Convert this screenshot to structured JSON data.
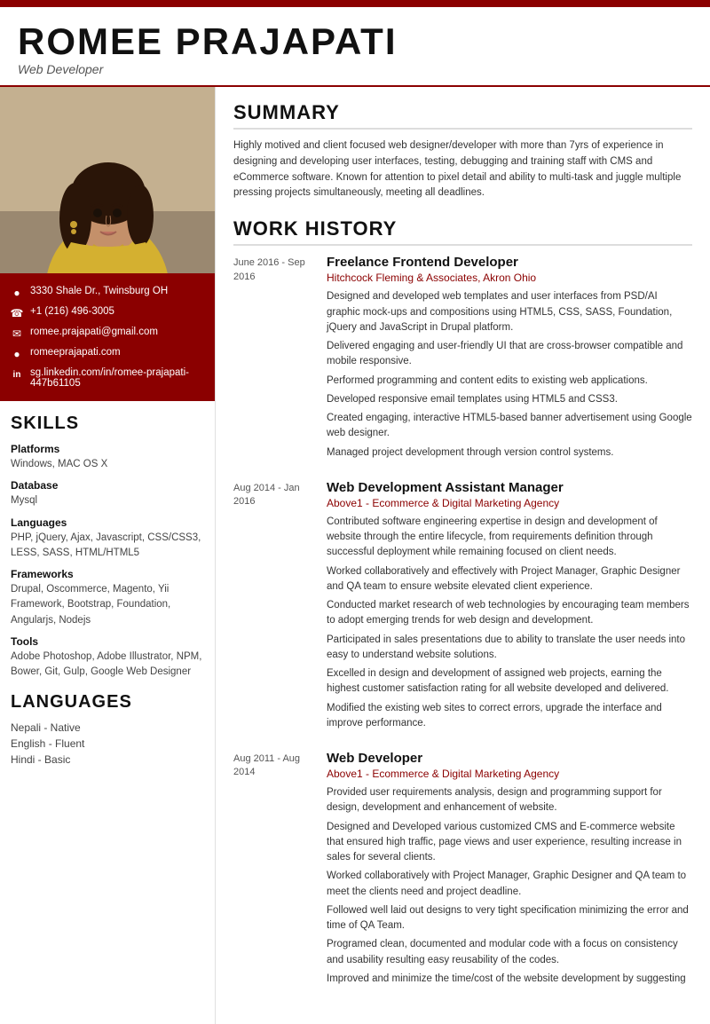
{
  "topbar": {},
  "header": {
    "name": "ROMEE PRAJAPATI",
    "title": "Web Developer"
  },
  "contact": {
    "address": "3330 Shale Dr., Twinsburg OH",
    "phone": "+1 (216) 496-3005",
    "email": "romee.prajapati@gmail.com",
    "website": "romeeprajapati.com",
    "linkedin": "sg.linkedin.com/in/romee-prajapati-447b61105"
  },
  "skills": {
    "section_title": "SKILLS",
    "categories": [
      {
        "name": "Platforms",
        "values": "Windows, MAC OS X"
      },
      {
        "name": "Database",
        "values": "Mysql"
      },
      {
        "name": "Languages",
        "values": "PHP, jQuery, Ajax, Javascript, CSS/CSS3, LESS, SASS, HTML/HTML5"
      },
      {
        "name": "Frameworks",
        "values": "Drupal, Oscommerce, Magento, Yii Framework, Bootstrap, Foundation, Angularjs, Nodejs"
      },
      {
        "name": "Tools",
        "values": "Adobe Photoshop, Adobe Illustrator, NPM, Bower, Git, Gulp, Google Web Designer"
      }
    ]
  },
  "languages": {
    "section_title": "LANGUAGES",
    "items": [
      "Nepali - Native",
      "English - Fluent",
      "Hindi - Basic"
    ]
  },
  "summary": {
    "section_title": "SUMMARY",
    "text": "Highly motived and client focused web designer/developer with more than 7yrs of experience in designing and developing user interfaces, testing, debugging and training staff with CMS and eCommerce software. Known for attention to pixel detail and ability to multi-task and juggle multiple pressing projects simultaneously, meeting all deadlines."
  },
  "work_history": {
    "section_title": "WORK HISTORY",
    "entries": [
      {
        "date": "June 2016 - Sep 2016",
        "title": "Freelance Frontend Developer",
        "company": "Hitchcock Fleming & Associates, Akron Ohio",
        "bullets": [
          "Designed and developed web templates and user interfaces from PSD/AI graphic mock-ups and compositions using HTML5, CSS, SASS, Foundation, jQuery and JavaScript in Drupal platform.",
          "Delivered engaging and user-friendly UI that are cross-browser compatible and mobile responsive.",
          "Performed programming and content edits to existing web applications.",
          "Developed responsive email templates using HTML5 and CSS3.",
          "Created engaging, interactive HTML5-based banner advertisement using Google web designer.",
          "Managed project development through version control systems."
        ]
      },
      {
        "date": "Aug 2014 - Jan 2016",
        "title": "Web Development Assistant Manager",
        "company": "Above1 - Ecommerce & Digital Marketing Agency",
        "bullets": [
          "Contributed software engineering expertise in design and development of website through the entire lifecycle, from requirements definition through successful deployment while remaining focused on client needs.",
          "Worked collaboratively and effectively with Project Manager, Graphic Designer and QA team to ensure website elevated client experience.",
          "Conducted market research of web technologies by encouraging team members to adopt emerging trends for web design and development.",
          "Participated in sales presentations due to ability to translate the user needs into easy to understand website solutions.",
          "Excelled in design and development of assigned web projects, earning the highest customer satisfaction rating for all website developed and delivered.",
          "Modified the existing web sites to correct errors, upgrade the interface and improve performance."
        ]
      },
      {
        "date": "Aug 2011 - Aug 2014",
        "title": "Web Developer",
        "company": "Above1 - Ecommerce & Digital Marketing Agency",
        "bullets": [
          "Provided user requirements analysis, design and programming support for design, development and enhancement of website.",
          "Designed and Developed various customized CMS and E-commerce website that ensured high traffic, page views and user experience, resulting increase in sales for several clients.",
          "Worked collaboratively with Project Manager, Graphic Designer and QA team to meet the clients need and project deadline.",
          "Followed well laid out designs to very tight specification minimizing the error and time of QA Team.",
          "Programed clean, documented and modular code with a focus on consistency and usability resulting easy reusability of the codes.",
          "Improved and minimize the time/cost of the website development by suggesting"
        ]
      }
    ]
  }
}
